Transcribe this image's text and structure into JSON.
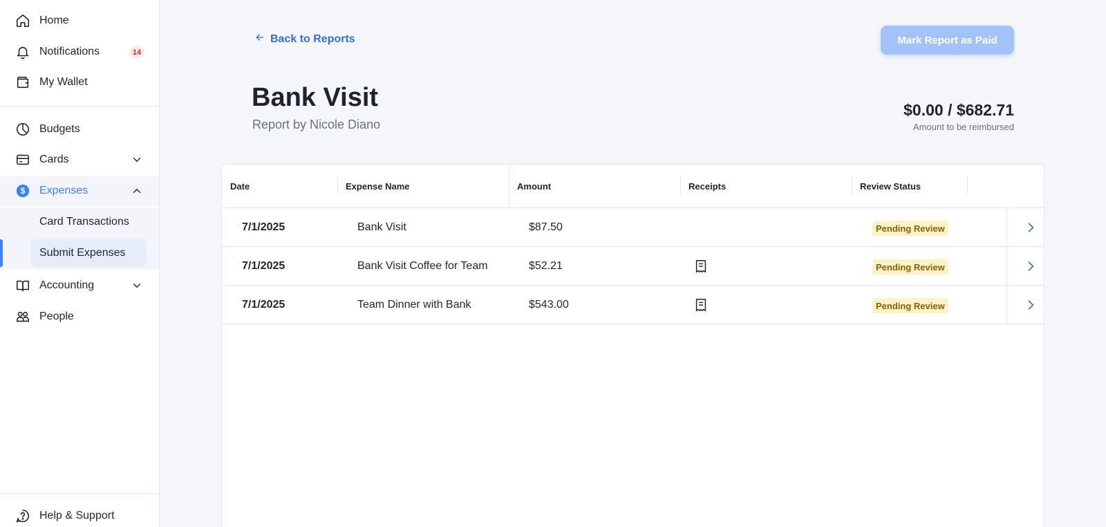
{
  "sidebar": {
    "items": [
      {
        "label": "Home",
        "icon": "home-icon"
      },
      {
        "label": "Notifications",
        "icon": "bell-icon",
        "badge": "14"
      },
      {
        "label": "My Wallet",
        "icon": "wallet-icon"
      },
      {
        "label": "Budgets",
        "icon": "pie-chart-icon"
      },
      {
        "label": "Cards",
        "icon": "credit-card-icon"
      },
      {
        "label": "Expenses",
        "icon": "dollar-circle-icon"
      },
      {
        "label": "Accounting",
        "icon": "book-icon"
      },
      {
        "label": "People",
        "icon": "people-icon"
      }
    ],
    "sub_items": [
      {
        "label": "Card Transactions"
      },
      {
        "label": "Submit Expenses"
      }
    ],
    "footer": {
      "label": "Help & Support",
      "icon": "help-icon"
    }
  },
  "header": {
    "back_label": "Back to Reports",
    "mark_paid_label": "Mark Report as Paid",
    "title": "Bank Visit",
    "subtitle": "Report by Nicole Diano",
    "amount": "$0.00 / $682.71",
    "amount_caption": "Amount to be reimbursed"
  },
  "table": {
    "columns": [
      "Date",
      "Expense Name",
      "Amount",
      "Receipts",
      "Review Status"
    ],
    "rows": [
      {
        "date": "7/1/2025",
        "name": "Bank Visit",
        "amount": "$87.50",
        "receipt": false,
        "status": "Pending Review"
      },
      {
        "date": "7/1/2025",
        "name": "Bank Visit Coffee for Team",
        "amount": "$52.21",
        "receipt": true,
        "status": "Pending Review"
      },
      {
        "date": "7/1/2025",
        "name": "Team Dinner with Bank",
        "amount": "$543.00",
        "receipt": true,
        "status": "Pending Review"
      }
    ]
  },
  "colors": {
    "accent": "#3b82f6",
    "link": "#2f6fe0",
    "button_disabled": "#a3c2f9",
    "status_bg": "#fdf1c7",
    "status_text": "#8a6100",
    "badge_text": "#d42a2a"
  }
}
